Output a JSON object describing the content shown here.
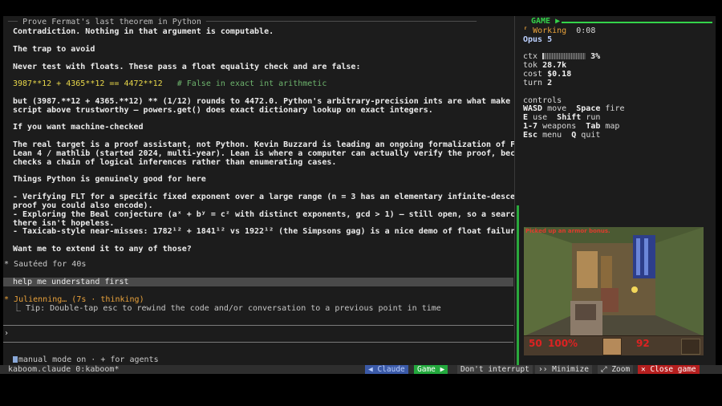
{
  "session": {
    "title": "Prove Fermat's last theorem in Python",
    "lines": [
      {
        "text": "Contradiction. Nothing in that argument is computable.",
        "style": "b"
      },
      {
        "text": "The trap to avoid",
        "style": "b"
      },
      {
        "text": "Never test with floats. These pass a float equality check and are false:",
        "style": "b"
      },
      {
        "text": "but (3987.**12 + 4365.**12) ** (1/12) rounds to 4472.0. Python's arbitrary-precision ints are what make the",
        "style": "b"
      },
      {
        "text": "script above trustworthy — powers.get() does exact dictionary lookup on exact integers.",
        "style": "b"
      },
      {
        "text": "If you want machine-checked",
        "style": "b"
      },
      {
        "text": "The real target is a proof assistant, not Python. Kevin Buzzard is leading an ongoing formalization of FLT in",
        "style": "b"
      },
      {
        "text": "Lean 4 / mathlib (started 2024, multi-year). Lean is where a computer can actually verify the proof, because it",
        "style": "b"
      },
      {
        "text": "checks a chain of logical inferences rather than enumerating cases.",
        "style": "b"
      },
      {
        "text": "Things Python is genuinely good for here",
        "style": "b"
      },
      {
        "text": "- Verifying FLT for a specific fixed exponent over a large range (n = 3 has an elementary infinite-descent",
        "style": "b"
      },
      {
        "text": "proof you could also encode).",
        "style": "b"
      },
      {
        "text": "- Exploring the Beal conjecture (aˣ + bʸ = cᶻ with distinct exponents, gcd > 1) — still open, so a search",
        "style": "b"
      },
      {
        "text": "there isn't hopeless.",
        "style": "b"
      },
      {
        "text": "- Taxicab-style near-misses: 1782¹² + 1841¹² vs 1922¹² (the Simpsons gag) is a nice demo of float failure.",
        "style": "b"
      },
      {
        "text": "Want me to extend it to any of those?",
        "style": "b"
      }
    ],
    "code_line": {
      "expr": "3987**12 + 4365**12 == 4472**12",
      "comment": "# False in exact int arithmetic"
    },
    "sauteed": "Sautéed for 40s",
    "user_message": "help me understand first",
    "thinking": "Julienning… (7s · thinking)",
    "tip": "⎿  Tip: Double-tap esc to rewind the code and/or conversation to a previous point in time",
    "prompt_symbol": "›",
    "mode_line": "manual mode on · + for agents"
  },
  "game_panel": {
    "header": "GAME ▶",
    "status": "Working",
    "timer": "0:08",
    "model": "Opus 5",
    "ctx_label": "ctx",
    "ctx_pct": "3%",
    "ctx_fill": 0.03,
    "tok_label": "tok",
    "tok": "28.7k",
    "cost_label": "cost",
    "cost": "$0.18",
    "turn_label": "turn",
    "turn": "2",
    "controls_title": "controls",
    "controls": [
      [
        {
          "k": "WASD",
          "v": "move"
        },
        {
          "k": "Space",
          "v": "fire"
        }
      ],
      [
        {
          "k": "E",
          "v": "use"
        },
        {
          "k": "Shift",
          "v": "run"
        }
      ],
      [
        {
          "k": "1-7",
          "v": "weapons"
        },
        {
          "k": "Tab",
          "v": "map"
        }
      ],
      [
        {
          "k": "Esc",
          "v": "menu"
        },
        {
          "k": "Q",
          "v": "quit"
        }
      ]
    ],
    "game_banner": "Picked up an armor bonus.",
    "hud_ammo": "50",
    "hud_health": "100%",
    "hud_armor": "92"
  },
  "statusbar": {
    "left": "kaboom.claude    0:kaboom*",
    "buttons": {
      "claude": "◀ Claude",
      "game": "Game ▶",
      "dont_interrupt": "Don't interrupt",
      "minimize": "›› Minimize",
      "zoom": "⤢ Zoom",
      "close": "✕ Close game"
    }
  },
  "colors": {
    "accent_green": "#34d34a",
    "code_yellow": "#e8d74a",
    "thinking_orange": "#e9a23b",
    "close_red": "#b51f1f",
    "claude_blue": "#3b5aa8"
  }
}
